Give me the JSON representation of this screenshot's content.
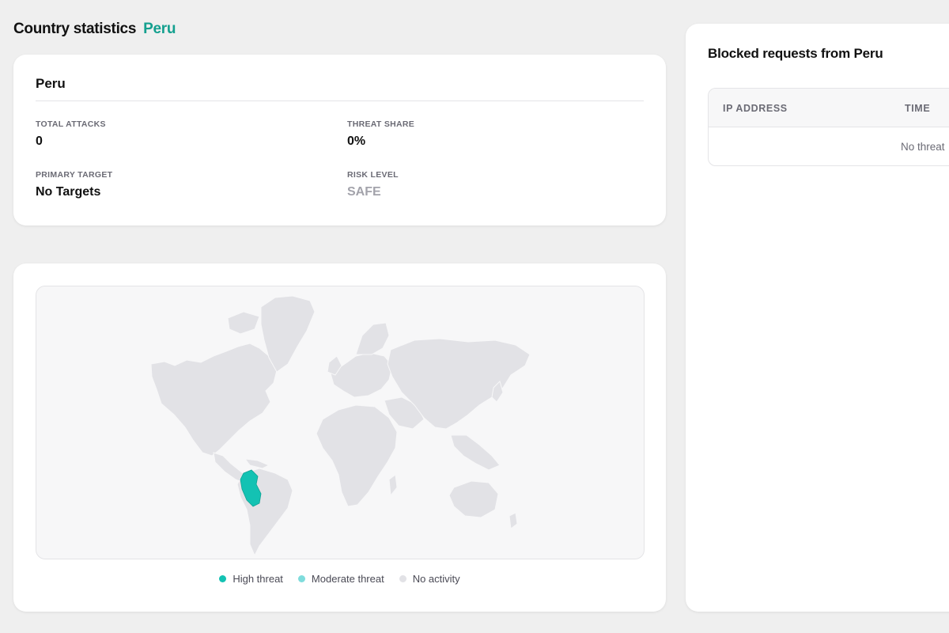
{
  "header": {
    "title": "Country statistics",
    "country": "Peru"
  },
  "stats": {
    "title": "Peru",
    "total_attacks": {
      "label": "TOTAL ATTACKS",
      "value": "0"
    },
    "threat_share": {
      "label": "THREAT SHARE",
      "value": "0%"
    },
    "primary_target": {
      "label": "PRIMARY TARGET",
      "value": "No Targets"
    },
    "risk_level": {
      "label": "RISK LEVEL",
      "value": "SAFE"
    }
  },
  "map": {
    "highlighted_country": "Peru",
    "colors": {
      "high": "#13c2b3",
      "moderate": "#7fdcdc",
      "none": "#e2e2e6"
    },
    "legend": [
      {
        "label": "High threat",
        "color": "#13c2b3"
      },
      {
        "label": "Moderate threat",
        "color": "#7fdcdc"
      },
      {
        "label": "No activity",
        "color": "#e2e2e6"
      }
    ]
  },
  "blocked": {
    "title": "Blocked requests from Peru",
    "columns": [
      "IP ADDRESS",
      "TIME"
    ],
    "empty_message": "No threat"
  }
}
